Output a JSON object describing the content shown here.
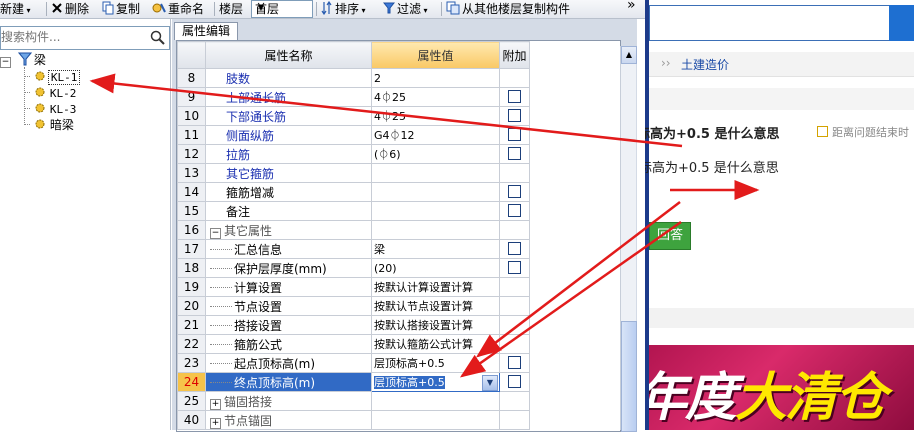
{
  "toolbar": {
    "new": "新建",
    "delete": "删除",
    "copy": "复制",
    "rename": "重命名",
    "floor_label": "楼层",
    "floor_value": "首层",
    "sort": "排序",
    "filter": "过滤",
    "copy_from_floor": "从其他楼层复制构件",
    "more": "»"
  },
  "left": {
    "search_placeholder": "搜索构件...",
    "root_label": "梁",
    "items": [
      "KL-1",
      "KL-2",
      "KL-3",
      "暗梁"
    ]
  },
  "prop_panel": {
    "tab": "属性编辑",
    "col_name": "属性名称",
    "col_value": "属性值",
    "col_extra": "附加",
    "rows": [
      {
        "num": "8",
        "name": "肢数",
        "value": "2",
        "check": false,
        "style": "blue"
      },
      {
        "num": "9",
        "name": "上部通长筋",
        "value": "4⏀25",
        "check": true,
        "style": "blue"
      },
      {
        "num": "10",
        "name": "下部通长筋",
        "value": "4⏀25",
        "check": true,
        "style": "blue"
      },
      {
        "num": "11",
        "name": "侧面纵筋",
        "value": "G4⏀12",
        "check": true,
        "style": "blue"
      },
      {
        "num": "12",
        "name": "拉筋",
        "value": "(⏀6)",
        "check": true,
        "style": "blue"
      },
      {
        "num": "13",
        "name": "其它箍筋",
        "value": "",
        "check": false,
        "style": "blue"
      },
      {
        "num": "14",
        "name": "箍筋增减",
        "value": "",
        "check": true,
        "style": "plain"
      },
      {
        "num": "15",
        "name": "备注",
        "value": "",
        "check": true,
        "style": "plain"
      },
      {
        "num": "16",
        "name": "其它属性",
        "value": "",
        "check": false,
        "style": "group-open"
      },
      {
        "num": "17",
        "name": "汇总信息",
        "value": "梁",
        "check": true,
        "style": "child"
      },
      {
        "num": "18",
        "name": "保护层厚度(mm)",
        "value": "(20)",
        "check": true,
        "style": "child"
      },
      {
        "num": "19",
        "name": "计算设置",
        "value": "按默认计算设置计算",
        "check": false,
        "style": "child"
      },
      {
        "num": "20",
        "name": "节点设置",
        "value": "按默认节点设置计算",
        "check": false,
        "style": "child"
      },
      {
        "num": "21",
        "name": "搭接设置",
        "value": "按默认搭接设置计算",
        "check": false,
        "style": "child"
      },
      {
        "num": "22",
        "name": "箍筋公式",
        "value": "按默认箍筋公式计算",
        "check": false,
        "style": "child"
      },
      {
        "num": "23",
        "name": "起点顶标高(m)",
        "value": "层顶标高+0.5",
        "check": true,
        "style": "child"
      },
      {
        "num": "24",
        "name": "终点顶标高(m)",
        "value": "层顶标高+0.5",
        "check": true,
        "style": "child-current"
      },
      {
        "num": "25",
        "name": "锚固搭接",
        "value": "",
        "check": false,
        "style": "group-closed"
      },
      {
        "num": "40",
        "name": "节点锚固",
        "value": "",
        "check": false,
        "style": "group-closed"
      }
    ]
  },
  "right": {
    "crumb_sep": "››",
    "crumb": "土建造价",
    "question_title": "标高为+0.5 是什么意思",
    "hint": "距离问题结束时",
    "question_body": "标高为+0.5 是什么意思",
    "answer_button": "回答",
    "banner_part1": "年度",
    "banner_part2": "大清仓"
  },
  "colors": {
    "arrow": "#e21b1b",
    "selection": "#316ac5",
    "value_header": "#f9c865"
  }
}
